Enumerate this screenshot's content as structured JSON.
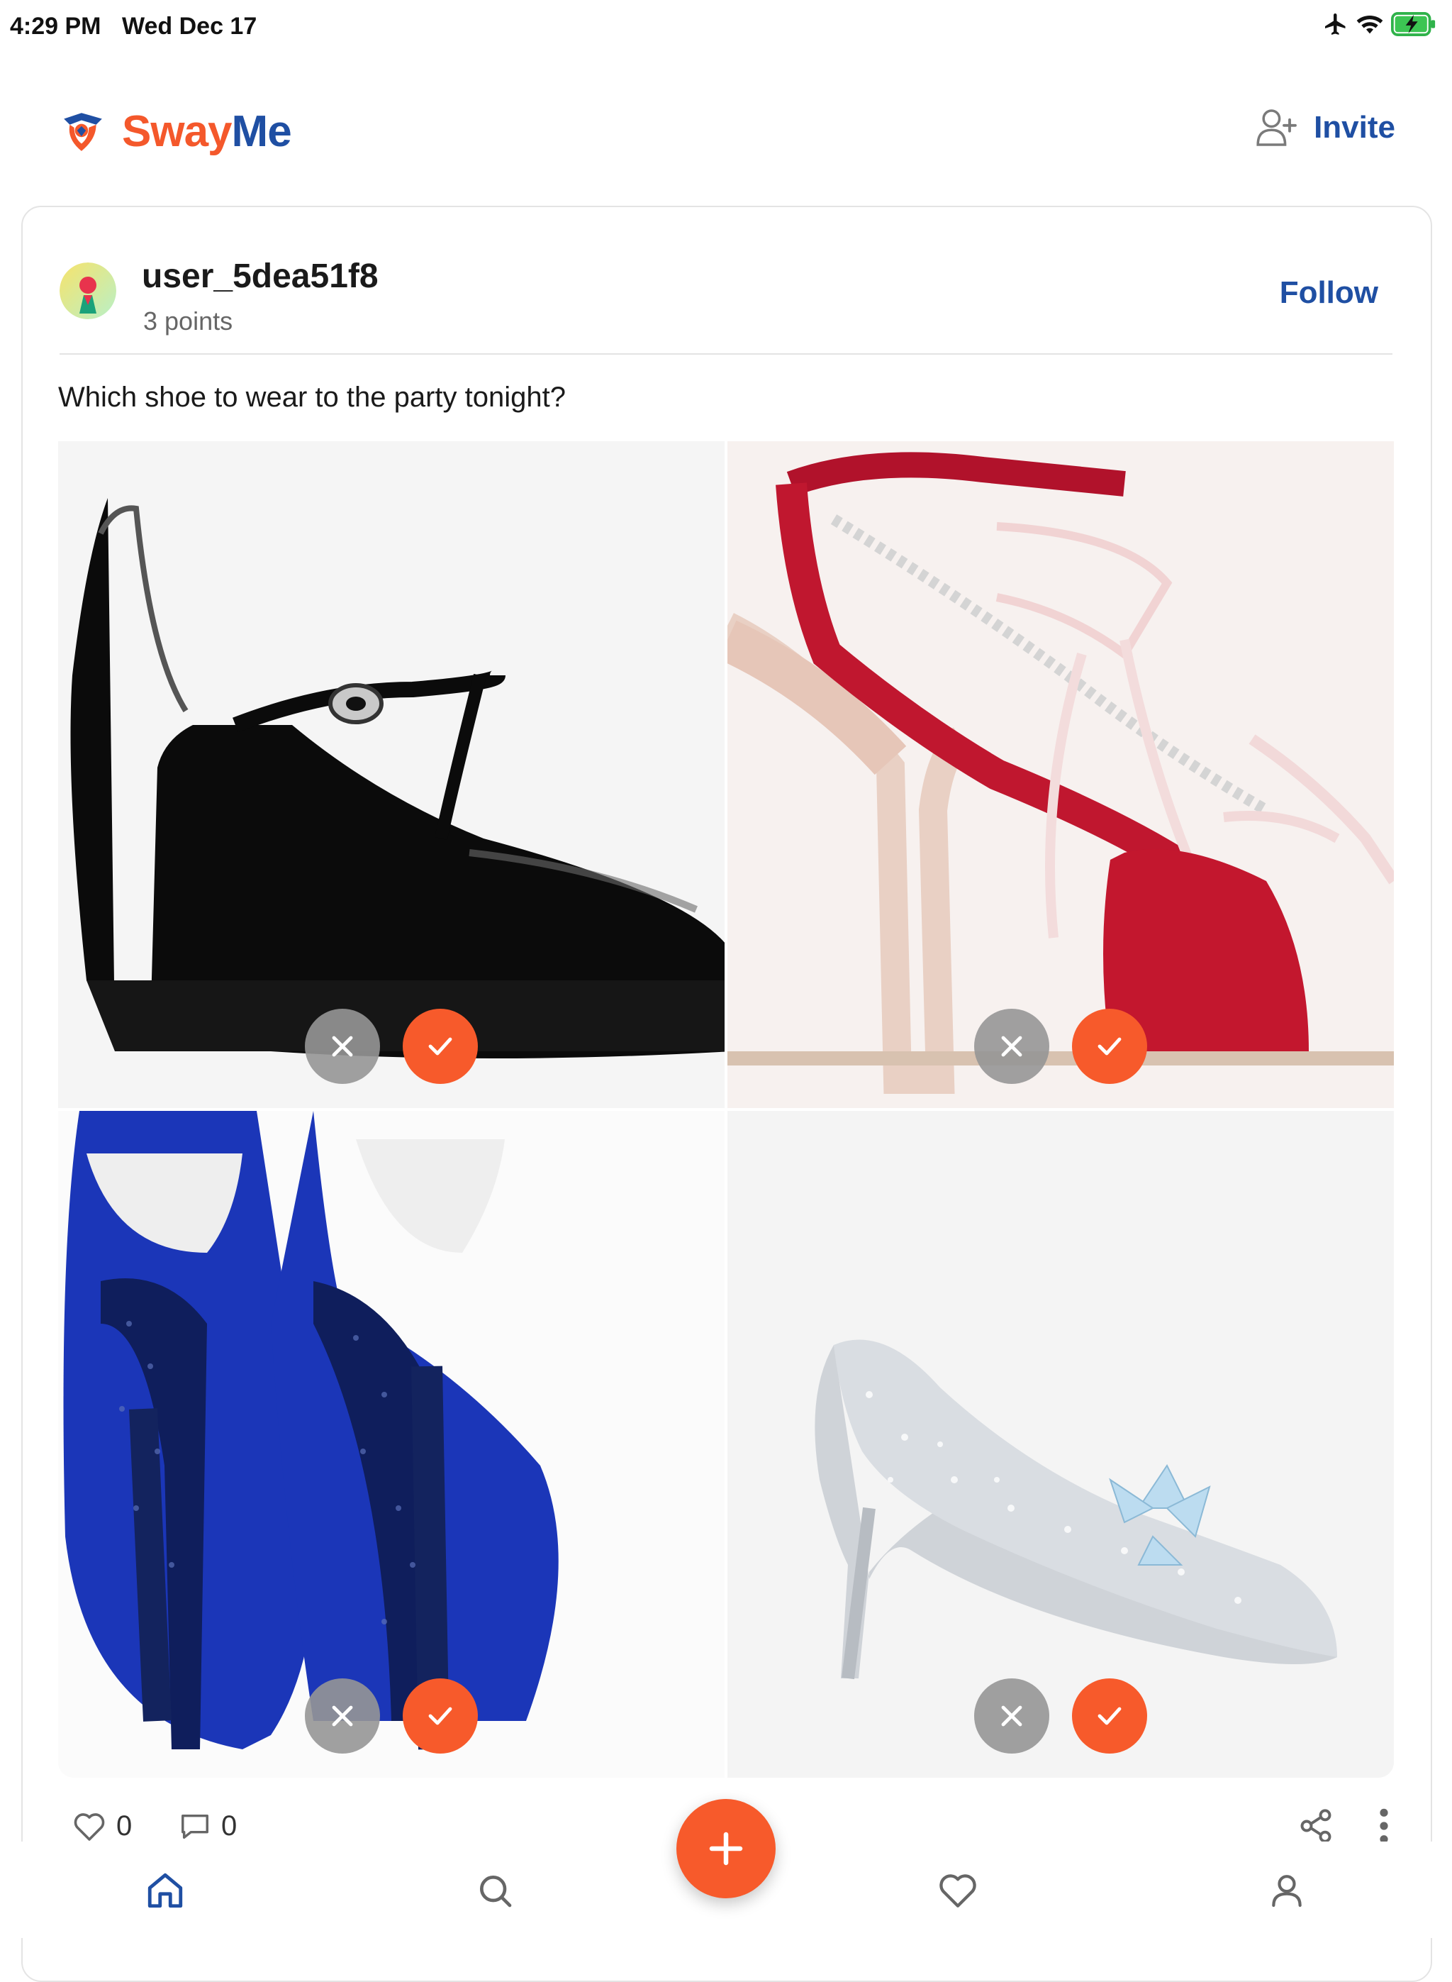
{
  "status_bar": {
    "time": "4:29 PM",
    "date": "Wed Dec 17"
  },
  "header": {
    "brand": {
      "part1": "Sway",
      "part2": "Me"
    },
    "invite_label": "Invite"
  },
  "post": {
    "username": "user_5dea51f8",
    "points": "3 points",
    "follow_label": "Follow",
    "question": "Which shoe to wear to the party tonight?",
    "options": [
      {
        "image": "black patent platform mary-jane heel"
      },
      {
        "image": "red satin strappy sandal with crystal bows"
      },
      {
        "image": "blue suede platform heels with crystal heels"
      },
      {
        "image": "silver crystal pointed pump"
      }
    ],
    "likes": "0",
    "comments": "0"
  },
  "colors": {
    "accent": "#f75a2b",
    "brand_blue": "#1f4fa3",
    "muted": "#969696"
  },
  "icons": {
    "status": [
      "airplane-icon",
      "wifi-icon",
      "battery-charging-icon"
    ],
    "nav": [
      "home-icon",
      "search-icon",
      "plus-icon",
      "heart-icon",
      "profile-icon"
    ]
  }
}
